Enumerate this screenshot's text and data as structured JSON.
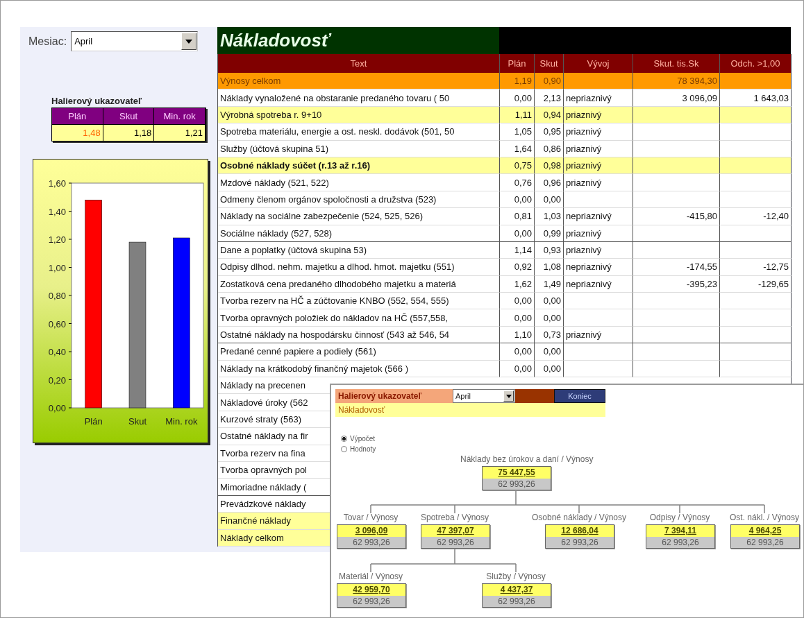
{
  "month_picker": {
    "label": "Mesiac:",
    "value": "April"
  },
  "indicator": {
    "title": "Halierový ukazovateľ",
    "columns": [
      "Plán",
      "Skut",
      "Min. rok"
    ],
    "values": [
      {
        "value": "1,48",
        "warning": true
      },
      {
        "value": "1,18",
        "warning": false
      },
      {
        "value": "1,21",
        "warning": false
      }
    ]
  },
  "chart_data": {
    "type": "bar",
    "stacked": true,
    "ylim": [
      0,
      1.6
    ],
    "yticks": [
      {
        "value": 0,
        "label": "0,00"
      },
      {
        "value": 0.2,
        "label": "0,20"
      },
      {
        "value": 0.4,
        "label": "0,40"
      },
      {
        "value": 0.6,
        "label": "0,60"
      },
      {
        "value": 0.8,
        "label": "0,80"
      },
      {
        "value": 1,
        "label": "1,00"
      },
      {
        "value": 1.2,
        "label": "1,20"
      },
      {
        "value": 1.4,
        "label": "1,40"
      },
      {
        "value": 1.6,
        "label": "1,60"
      }
    ],
    "series": [
      {
        "name": "Plán",
        "color": "#ff0000",
        "values": [
          1.48,
          null,
          null
        ]
      },
      {
        "name": "Skut",
        "color": "#808080",
        "values": [
          null,
          1.18,
          null
        ]
      },
      {
        "name": "Min. rok",
        "color": "#0000ff",
        "values": [
          null,
          null,
          1.21
        ]
      }
    ]
  },
  "table": {
    "title": "Nákladovosť",
    "columns": [
      "Text",
      "Plán",
      "Skut",
      "Vývoj",
      "Skut. tis.Sk",
      "Odch. >1,00"
    ],
    "rows": [
      {
        "kind": "total",
        "bold": false,
        "divider_after": false,
        "cells": [
          "Výnosy celkom",
          "1,19",
          "0,90",
          "",
          "78 394,30",
          ""
        ]
      },
      {
        "kind": "normal",
        "bold": false,
        "divider_after": false,
        "cells": [
          "Náklady vynaložené na obstaranie predaného tovaru  ( 50",
          "0,00",
          "2,13",
          "nepriaznivý",
          "3 096,09",
          "1 643,03"
        ]
      },
      {
        "kind": "subtotal",
        "bold": false,
        "divider_after": false,
        "cells": [
          "Výrobná spotreba r. 9+10",
          "1,11",
          "0,94",
          "priaznivý",
          "",
          ""
        ]
      },
      {
        "kind": "normal",
        "bold": false,
        "divider_after": false,
        "cells": [
          "Spotreba materiálu, energie a ost. neskl. dodávok  (501, 50",
          "1,05",
          "0,95",
          "priaznivý",
          "",
          ""
        ]
      },
      {
        "kind": "normal",
        "bold": false,
        "divider_after": false,
        "cells": [
          "Služby  (účtová skupina 51)",
          "1,64",
          "0,86",
          "priaznivý",
          "",
          ""
        ]
      },
      {
        "kind": "subtotal",
        "bold": true,
        "divider_after": false,
        "cells": [
          "Osobné náklady súčet (r.13 až r.16)",
          "0,75",
          "0,98",
          "priaznivý",
          "",
          ""
        ]
      },
      {
        "kind": "normal",
        "bold": false,
        "divider_after": false,
        "cells": [
          "Mzdové náklady  (521, 522)",
          "0,76",
          "0,96",
          "priaznivý",
          "",
          ""
        ]
      },
      {
        "kind": "normal",
        "bold": false,
        "divider_after": false,
        "cells": [
          "Odmeny členom  orgánov spoločnosti a družstva  (523)",
          "0,00",
          "0,00",
          "",
          "",
          ""
        ]
      },
      {
        "kind": "normal",
        "bold": false,
        "divider_after": false,
        "cells": [
          "Náklady na sociálne zabezpečenie   (524, 525, 526)",
          "0,81",
          "1,03",
          "nepriaznivý",
          "-415,80",
          "-12,40"
        ]
      },
      {
        "kind": "normal",
        "bold": false,
        "divider_after": true,
        "cells": [
          "Sociálne náklady   (527, 528)",
          "0,00",
          "0,99",
          "priaznivý",
          "",
          ""
        ]
      },
      {
        "kind": "normal",
        "bold": false,
        "divider_after": false,
        "cells": [
          "Dane a poplatky  (účtová skupina 53)",
          "1,14",
          "0,93",
          "priaznivý",
          "",
          ""
        ]
      },
      {
        "kind": "normal",
        "bold": false,
        "divider_after": false,
        "cells": [
          "Odpisy dlhod. nehm. majetku a dlhod. hmot. majetku   (551)",
          "0,92",
          "1,08",
          "nepriaznivý",
          "-174,55",
          "-12,75"
        ]
      },
      {
        "kind": "normal",
        "bold": false,
        "divider_after": false,
        "cells": [
          "Zostatková cena predaného dlhodobého majetku a materiá",
          "1,62",
          "1,49",
          "nepriaznivý",
          "-395,23",
          "-129,65"
        ]
      },
      {
        "kind": "normal",
        "bold": false,
        "divider_after": false,
        "cells": [
          "Tvorba rezerv na HČ a zúčtovanie KNBO  (552, 554, 555)",
          "0,00",
          "0,00",
          "",
          "",
          ""
        ]
      },
      {
        "kind": "normal",
        "bold": false,
        "divider_after": false,
        "cells": [
          "Tvorba opravných položiek do nákladov na HČ   (557,558,",
          "0,00",
          "0,00",
          "",
          "",
          ""
        ]
      },
      {
        "kind": "normal",
        "bold": false,
        "divider_after": true,
        "cells": [
          "Ostatné náklady na hospodársku činnosť  (543 až 546, 54",
          "1,10",
          "0,73",
          "priaznivý",
          "",
          ""
        ]
      },
      {
        "kind": "normal",
        "bold": false,
        "divider_after": false,
        "cells": [
          "Predané cenné papiere a podiely  (561)",
          "0,00",
          "0,00",
          "",
          "",
          ""
        ]
      },
      {
        "kind": "normal",
        "bold": false,
        "divider_after": false,
        "cells": [
          "Náklady na krátkodobý finančný majetok   (566 )",
          "0,00",
          "0,00",
          "",
          "",
          ""
        ]
      },
      {
        "kind": "normal",
        "bold": false,
        "divider_after": false,
        "cells": [
          "Náklady na  precenen"
        ]
      },
      {
        "kind": "normal",
        "bold": false,
        "divider_after": false,
        "cells": [
          "Nákladové úroky (562"
        ]
      },
      {
        "kind": "normal",
        "bold": false,
        "divider_after": false,
        "cells": [
          "Kurzové straty   (563)"
        ]
      },
      {
        "kind": "normal",
        "bold": false,
        "divider_after": false,
        "cells": [
          "Ostatné náklady na fir"
        ]
      },
      {
        "kind": "normal",
        "bold": false,
        "divider_after": false,
        "cells": [
          "Tvorba rezerv na fina"
        ]
      },
      {
        "kind": "normal",
        "bold": false,
        "divider_after": false,
        "cells": [
          "Tvorba opravných pol"
        ]
      },
      {
        "kind": "normal",
        "bold": false,
        "divider_after": true,
        "cells": [
          "Mimoriadne náklady   ("
        ]
      },
      {
        "kind": "normal",
        "bold": false,
        "divider_after": false,
        "cells": [
          "Prevádzkové náklady"
        ]
      },
      {
        "kind": "subtotal",
        "bold": false,
        "divider_after": false,
        "cells": [
          "Finančné náklady"
        ]
      },
      {
        "kind": "subtotal",
        "bold": false,
        "divider_after": false,
        "cells": [
          "Náklady celkom"
        ]
      }
    ]
  },
  "popup": {
    "title": "Halierový ukazovateľ",
    "month": "April",
    "close_button": "Koniec",
    "subtitle": "Nákladovosť",
    "modes": [
      {
        "label": "Výpočet",
        "selected": true
      },
      {
        "label": "Hodnoty",
        "selected": false
      }
    ],
    "tree": {
      "label": "Náklady bez úrokov a daní / Výnosy",
      "value": "75 447,55",
      "base": "62 993,26",
      "children": [
        {
          "label": "Tovar / Výnosy",
          "value": "3 096,09",
          "base": "62 993,26"
        },
        {
          "label": "Spotreba / Výnosy",
          "value": "47 397,07",
          "base": "62 993,26",
          "children": [
            {
              "label": "Materiál / Výnosy",
              "value": "42 959,70",
              "base": "62 993,26"
            },
            {
              "label": "Služby / Výnosy",
              "value": "4 437,37",
              "base": "62 993,26"
            }
          ]
        },
        {
          "label": "Osobné náklady / Výnosy",
          "value": "12 686,04",
          "base": "62 993,26"
        },
        {
          "label": "Odpisy / Výnosy",
          "value": "7 394,11",
          "base": "62 993,26"
        },
        {
          "label": "Ost. nákl. / Výnosy",
          "value": "4 964,25",
          "base": "62 993,26"
        }
      ]
    }
  }
}
